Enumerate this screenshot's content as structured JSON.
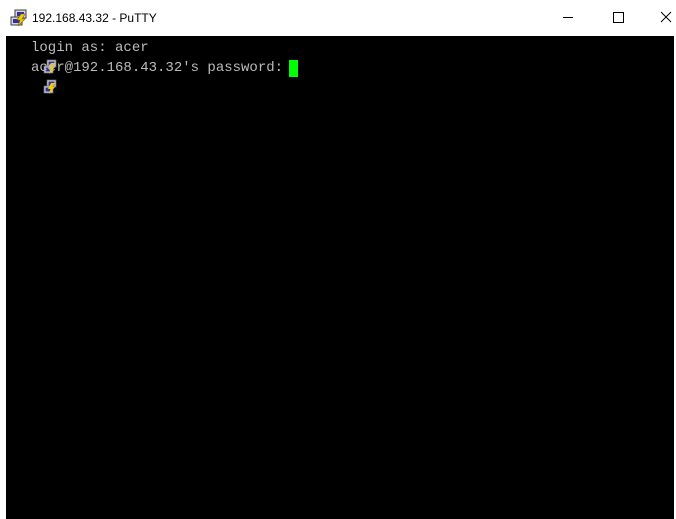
{
  "window": {
    "title": "192.168.43.32 - PuTTY",
    "app_icon": "putty-icon",
    "controls": {
      "minimize_icon": "minimize-icon",
      "maximize_icon": "maximize-icon",
      "close_icon": "close-icon"
    }
  },
  "terminal": {
    "background": "#000000",
    "text_color": "#bbbbbb",
    "cursor_color": "#00ff00",
    "lines": [
      {
        "icon": "putty-session-icon",
        "text": "login as: acer"
      },
      {
        "icon": "putty-session-icon",
        "text": "acer@192.168.43.32's password: "
      }
    ]
  }
}
